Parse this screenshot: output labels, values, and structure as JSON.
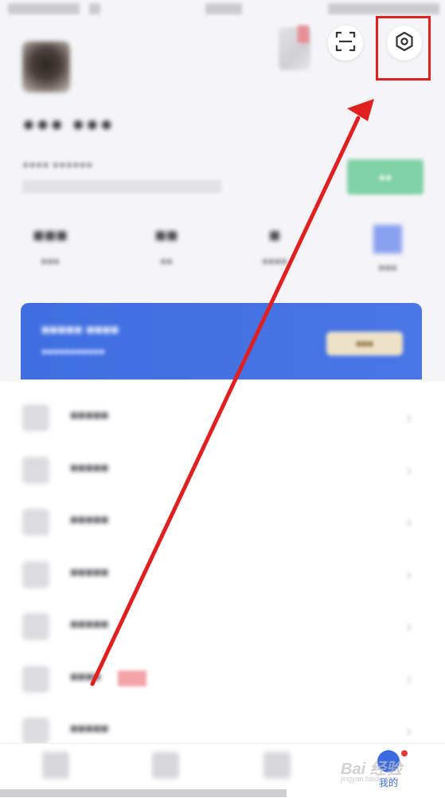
{
  "status_bar": {},
  "header": {
    "scan_icon": "scan-icon",
    "settings_icon": "settings-icon"
  },
  "profile": {
    "name": "●●● ●●●",
    "subtitle": "●●●● ●●●●●●",
    "action_label": "●●"
  },
  "stats": [
    {
      "value": "■■■",
      "label": "■■■"
    },
    {
      "value": "■■",
      "label": "■■"
    },
    {
      "value": "■",
      "label": "■■■■"
    },
    {
      "value": "",
      "label": "■■■"
    }
  ],
  "banner": {
    "title": "■■■■■ ■■■■",
    "subtitle": "■■■■■■■■■■■",
    "button": "■■■"
  },
  "menu": [
    {
      "label": "■■■■■"
    },
    {
      "label": "■■■■■"
    },
    {
      "label": "■■■■■"
    },
    {
      "label": "■■■■■"
    },
    {
      "label": "■■■■■"
    },
    {
      "label": "■■■■"
    },
    {
      "label": "■■■■■"
    }
  ],
  "tabbar": {
    "me_label": "我的"
  },
  "annotation": {
    "color": "#e02020"
  },
  "watermark": {
    "text": "Bai 经验",
    "url": "jingyan.baidu.com"
  },
  "colors": {
    "accent": "#3c6be0",
    "banner": "#4a76e6",
    "green": "#7fd1a6",
    "annotation": "#e02020"
  }
}
